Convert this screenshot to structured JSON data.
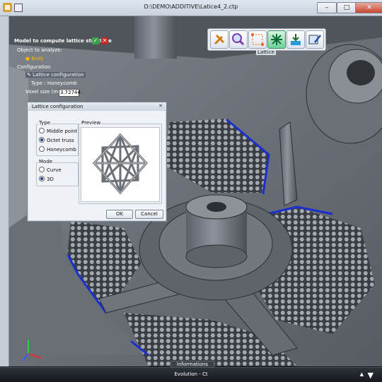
{
  "window": {
    "title": "D:\\DEMO\\ADDITIVE\\Latice4_2.ctp",
    "minimize": "–",
    "maximize": "□",
    "close": "✕"
  },
  "ribbon": {
    "icons": [
      "tools-icon",
      "inspect-icon",
      "points-icon",
      "lattice-icon",
      "export-icon",
      "edit-icon"
    ],
    "label": "Lattice"
  },
  "tree": {
    "header": "Model to compute lattice structure",
    "object_label": "Object to analyze:",
    "body_label": "Body",
    "configuration_label": "Configuration",
    "lattice_config_label": "Lattice configuration",
    "type_label": "Type : Honeycomb",
    "voxel_label": "Voxel size (mm):",
    "voxel_value": "3.72744"
  },
  "dialog": {
    "title": "Lattice configuration",
    "type_group": "Type",
    "type_options": [
      "Middle point",
      "Octet truss",
      "Honeycomb"
    ],
    "type_selected": 1,
    "mode_group": "Mode",
    "mode_options": [
      "Curve",
      "3D"
    ],
    "mode_selected": 1,
    "preview_label": "Preview",
    "ok": "OK",
    "cancel": "Cancel"
  },
  "bottom": {
    "info_tab": "Informations",
    "status": "Evolution - Ct"
  },
  "colors": {
    "accent_blue": "#1a2fd0",
    "part_gray": "#6e737b",
    "honeycomb": "#8d9199"
  }
}
